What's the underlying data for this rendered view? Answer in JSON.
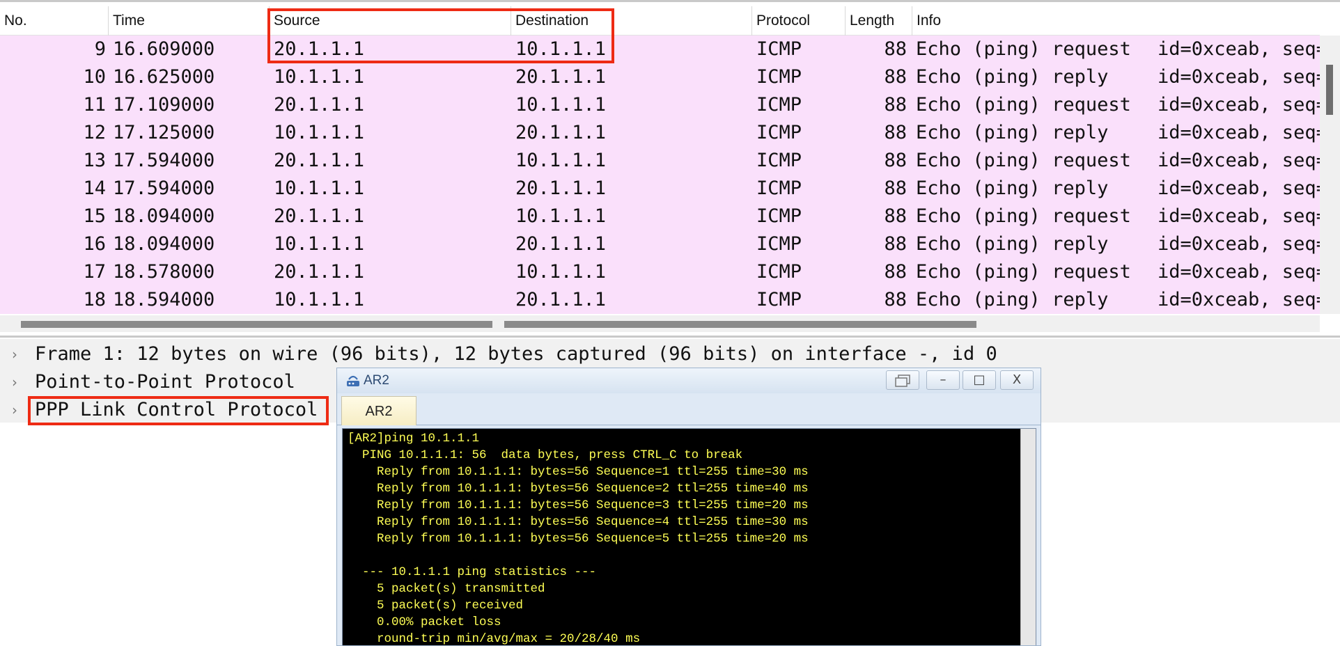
{
  "packet_list": {
    "columns": [
      "No.",
      "Time",
      "Source",
      "Destination",
      "Protocol",
      "Length",
      "Info"
    ],
    "rows": [
      {
        "no": "9",
        "time": "16.609000",
        "source": "20.1.1.1",
        "destination": "10.1.1.1",
        "protocol": "ICMP",
        "length": "88",
        "info": "Echo (ping) request",
        "info_id": "id=0xceab, seq="
      },
      {
        "no": "10",
        "time": "16.625000",
        "source": "10.1.1.1",
        "destination": "20.1.1.1",
        "protocol": "ICMP",
        "length": "88",
        "info": "Echo (ping) reply",
        "info_id": "id=0xceab, seq="
      },
      {
        "no": "11",
        "time": "17.109000",
        "source": "20.1.1.1",
        "destination": "10.1.1.1",
        "protocol": "ICMP",
        "length": "88",
        "info": "Echo (ping) request",
        "info_id": "id=0xceab, seq="
      },
      {
        "no": "12",
        "time": "17.125000",
        "source": "10.1.1.1",
        "destination": "20.1.1.1",
        "protocol": "ICMP",
        "length": "88",
        "info": "Echo (ping) reply",
        "info_id": "id=0xceab, seq="
      },
      {
        "no": "13",
        "time": "17.594000",
        "source": "20.1.1.1",
        "destination": "10.1.1.1",
        "protocol": "ICMP",
        "length": "88",
        "info": "Echo (ping) request",
        "info_id": "id=0xceab, seq="
      },
      {
        "no": "14",
        "time": "17.594000",
        "source": "10.1.1.1",
        "destination": "20.1.1.1",
        "protocol": "ICMP",
        "length": "88",
        "info": "Echo (ping) reply",
        "info_id": "id=0xceab, seq="
      },
      {
        "no": "15",
        "time": "18.094000",
        "source": "20.1.1.1",
        "destination": "10.1.1.1",
        "protocol": "ICMP",
        "length": "88",
        "info": "Echo (ping) request",
        "info_id": "id=0xceab, seq="
      },
      {
        "no": "16",
        "time": "18.094000",
        "source": "10.1.1.1",
        "destination": "20.1.1.1",
        "protocol": "ICMP",
        "length": "88",
        "info": "Echo (ping) reply",
        "info_id": "id=0xceab, seq="
      },
      {
        "no": "17",
        "time": "18.578000",
        "source": "20.1.1.1",
        "destination": "10.1.1.1",
        "protocol": "ICMP",
        "length": "88",
        "info": "Echo (ping) request",
        "info_id": "id=0xceab, seq="
      },
      {
        "no": "18",
        "time": "18.594000",
        "source": "10.1.1.1",
        "destination": "20.1.1.1",
        "protocol": "ICMP",
        "length": "88",
        "info": "Echo (ping) reply",
        "info_id": "id=0xceab, seq="
      }
    ],
    "row_color": "#fae0fb",
    "highlight_color": "#ee2b14"
  },
  "details": {
    "items": [
      "Frame 1: 12 bytes on wire (96 bits), 12 bytes captured (96 bits) on interface -, id 0",
      "Point-to-Point Protocol",
      "PPP Link Control Protocol"
    ],
    "expand_glyph": "›"
  },
  "ar2_window": {
    "title": "AR2",
    "tab_label": "AR2",
    "buttons": {
      "restore": "",
      "minimize": "–",
      "maximize": "□",
      "close": "X"
    },
    "console_lines": [
      "[AR2]ping 10.1.1.1",
      "  PING 10.1.1.1: 56  data bytes, press CTRL_C to break",
      "    Reply from 10.1.1.1: bytes=56 Sequence=1 ttl=255 time=30 ms",
      "    Reply from 10.1.1.1: bytes=56 Sequence=2 ttl=255 time=40 ms",
      "    Reply from 10.1.1.1: bytes=56 Sequence=3 ttl=255 time=20 ms",
      "    Reply from 10.1.1.1: bytes=56 Sequence=4 ttl=255 time=30 ms",
      "    Reply from 10.1.1.1: bytes=56 Sequence=5 ttl=255 time=20 ms",
      "",
      "  --- 10.1.1.1 ping statistics ---",
      "    5 packet(s) transmitted",
      "    5 packet(s) received",
      "    0.00% packet loss",
      "    round-trip min/avg/max = 20/28/40 ms"
    ],
    "console_text_color": "#ffff55"
  }
}
